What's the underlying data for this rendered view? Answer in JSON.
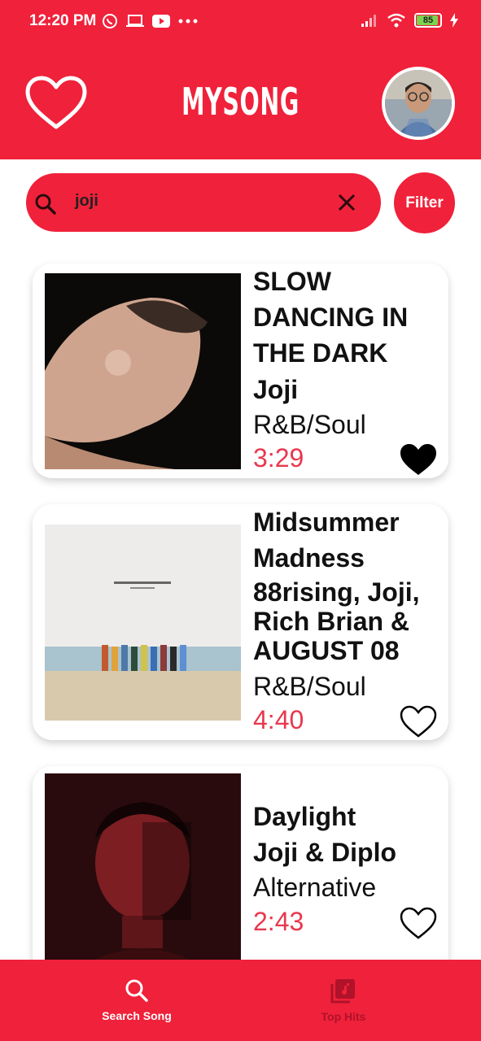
{
  "status_bar": {
    "time": "12:20 PM",
    "battery": "85",
    "icons_left": [
      "whatsapp-icon",
      "laptop-icon",
      "youtube-icon",
      "more-icon"
    ],
    "icons_right": [
      "signal-icon",
      "wifi-icon",
      "battery-icon",
      "charging-icon"
    ]
  },
  "header": {
    "title": "MYSONG"
  },
  "search": {
    "value": "joji",
    "filter_label": "Filter"
  },
  "songs": [
    {
      "title": "SLOW DANCING IN THE DARK",
      "artist": "Joji",
      "genre": "R&B/Soul",
      "duration": "3:29",
      "favorite": true
    },
    {
      "title": "Midsummer Madness",
      "artist": "88rising, Joji, Rich Brian & AUGUST 08",
      "genre": "R&B/Soul",
      "duration": "4:40",
      "favorite": false
    },
    {
      "title": "Daylight",
      "artist": "Joji & Diplo",
      "genre": "Alternative",
      "duration": "2:43",
      "favorite": false
    }
  ],
  "nav": [
    {
      "label": "Search Song",
      "icon": "search-icon",
      "active": true
    },
    {
      "label": "Top Hits",
      "icon": "music-library-icon",
      "active": false
    }
  ],
  "colors": {
    "accent": "#f0213a",
    "duration": "#e8384e",
    "inactive_nav": "#b0122a"
  }
}
